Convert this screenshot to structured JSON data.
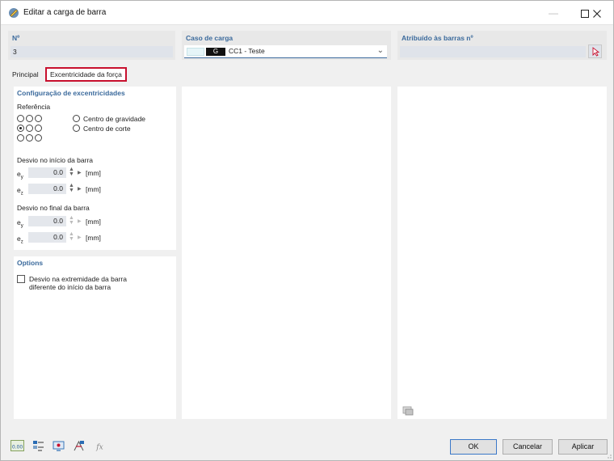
{
  "window": {
    "title": "Editar a carga de barra"
  },
  "header": {
    "number_label": "Nº",
    "number_value": "3",
    "loadcase_label": "Caso de carga",
    "loadcase_code": "G",
    "loadcase_name": "CC1 - Teste",
    "loadcase_color": "#e6f5f8",
    "assigned_label": "Atribuído às barras nº",
    "assigned_value": ""
  },
  "tabs": [
    {
      "label": "Principal",
      "active": false
    },
    {
      "label": "Excentricidade da força",
      "active": true
    }
  ],
  "eccentricity": {
    "title": "Configuração de excentricidades",
    "reference_label": "Referência",
    "selected_reference_cell": "middle-left",
    "center_gravity": "Centro de gravidade",
    "shear_center": "Centro de corte",
    "start_title": "Desvio no início da barra",
    "end_title": "Desvio no final da barra",
    "ey_label": "ey",
    "ez_label": "ez",
    "start_ey": "0.0",
    "start_ez": "0.0",
    "end_ey": "0.0",
    "end_ez": "0.0",
    "unit": "[mm]"
  },
  "options": {
    "title": "Options",
    "checkbox_line1": "Desvio na extremidade da barra",
    "checkbox_line2": "diferente do início da barra",
    "checked": false
  },
  "buttons": {
    "ok": "OK",
    "cancel": "Cancelar",
    "apply": "Aplicar"
  },
  "toolbar": {
    "units_icon_text": "0.00",
    "function_icon_text": "fx"
  },
  "colors": {
    "accent": "#3b6a9c",
    "tab_highlight": "#c8102e"
  }
}
